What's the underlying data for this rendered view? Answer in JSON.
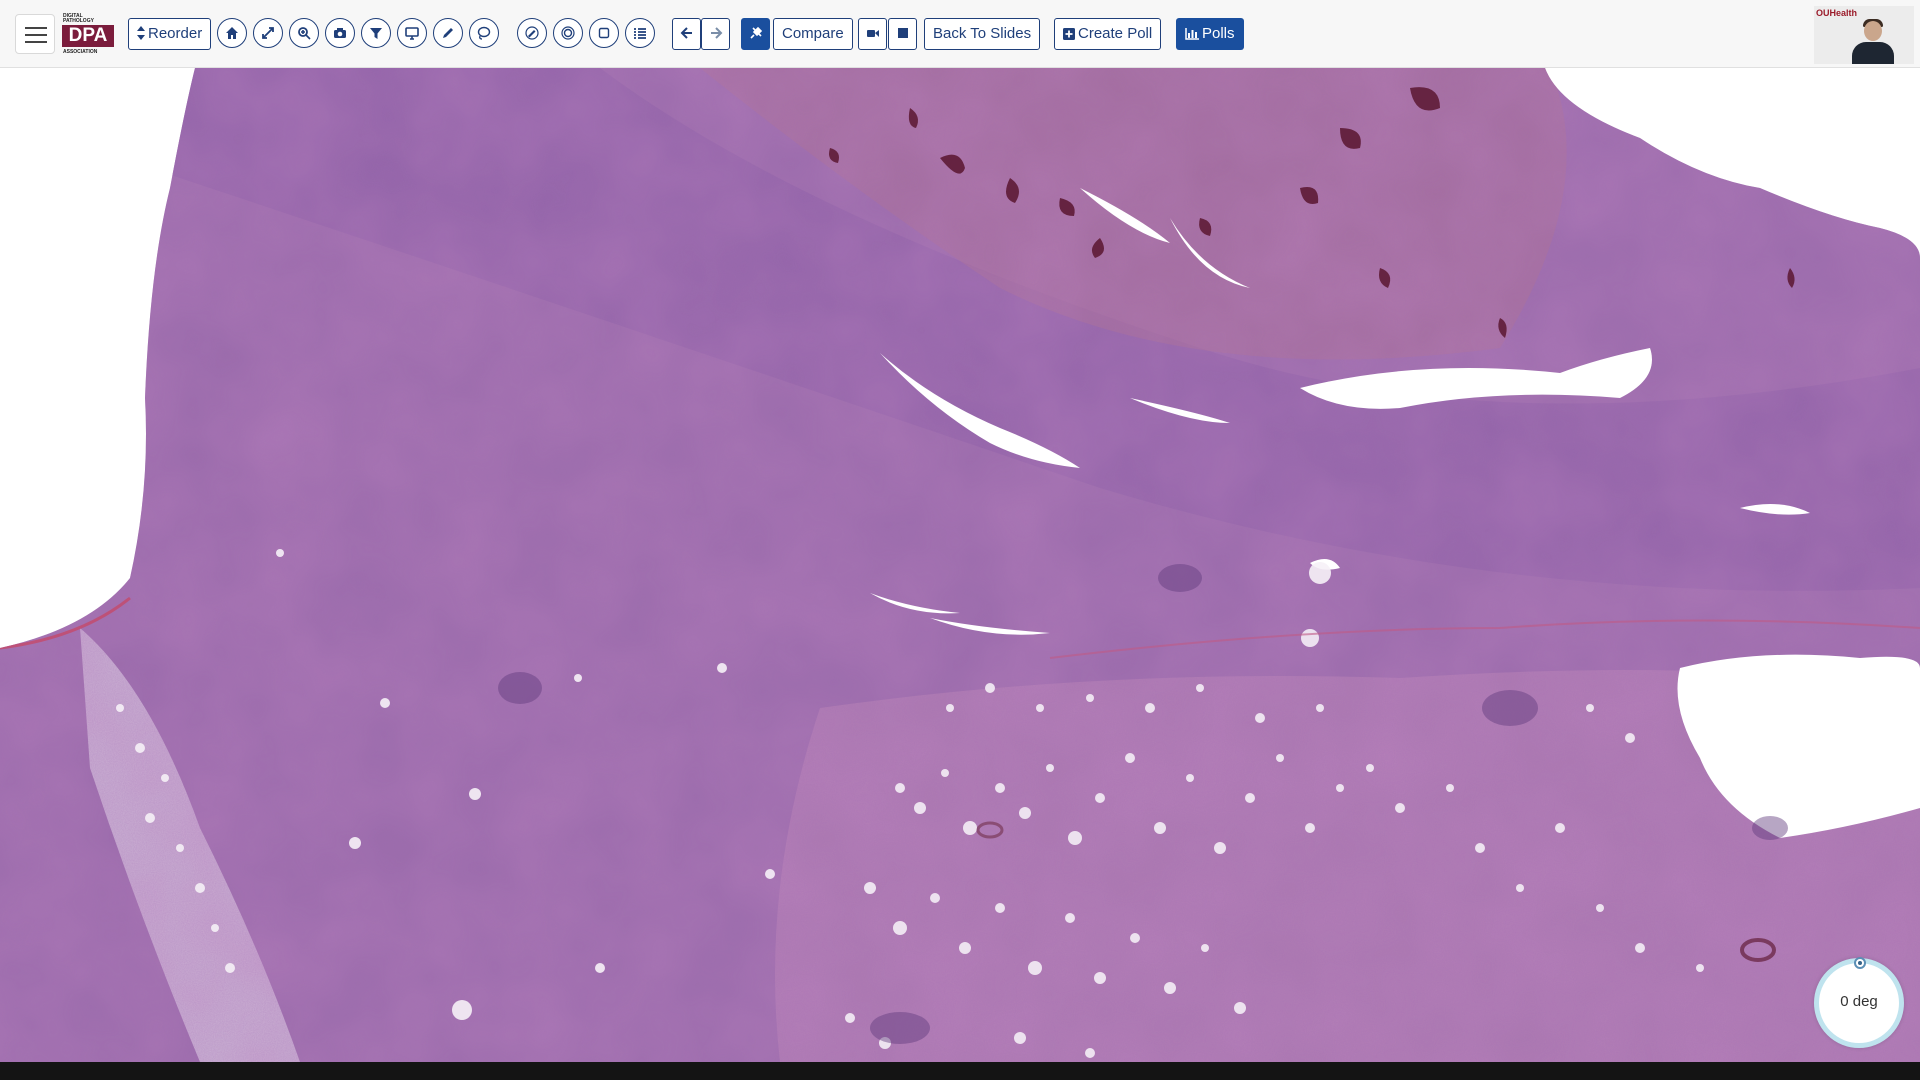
{
  "logo": {
    "line1": "DIGITAL",
    "line2": "PATHOLOGY",
    "mark": "DPA",
    "line3": "ASSOCIATION"
  },
  "toolbar": {
    "reorder_label": "Reorder",
    "icons": [
      "home-icon",
      "expand-icon",
      "zoom-icon",
      "camera-icon",
      "filter-icon",
      "monitor-icon",
      "pencil-icon",
      "lasso-icon",
      "freehand-icon",
      "circle-target-icon",
      "square-icon",
      "list-icon"
    ],
    "prev_icon": "arrow-left-icon",
    "next_icon": "arrow-right-icon",
    "pin_icon": "pin-icon",
    "compare_label": "Compare",
    "video_icon": "video-camera-icon",
    "stop_icon": "stop-icon",
    "back_to_slides_label": "Back To Slides",
    "create_poll_label": "Create Poll",
    "polls_label": "Polls"
  },
  "speaker": {
    "brand": "OUHealth"
  },
  "viewer": {
    "rotation_label": "0 deg"
  },
  "colors": {
    "primary": "#1a4f9e",
    "outline": "#1f3f7a",
    "logo": "#7b1c3c",
    "tissue": "#9a6aa8",
    "background": "#ffffff"
  }
}
